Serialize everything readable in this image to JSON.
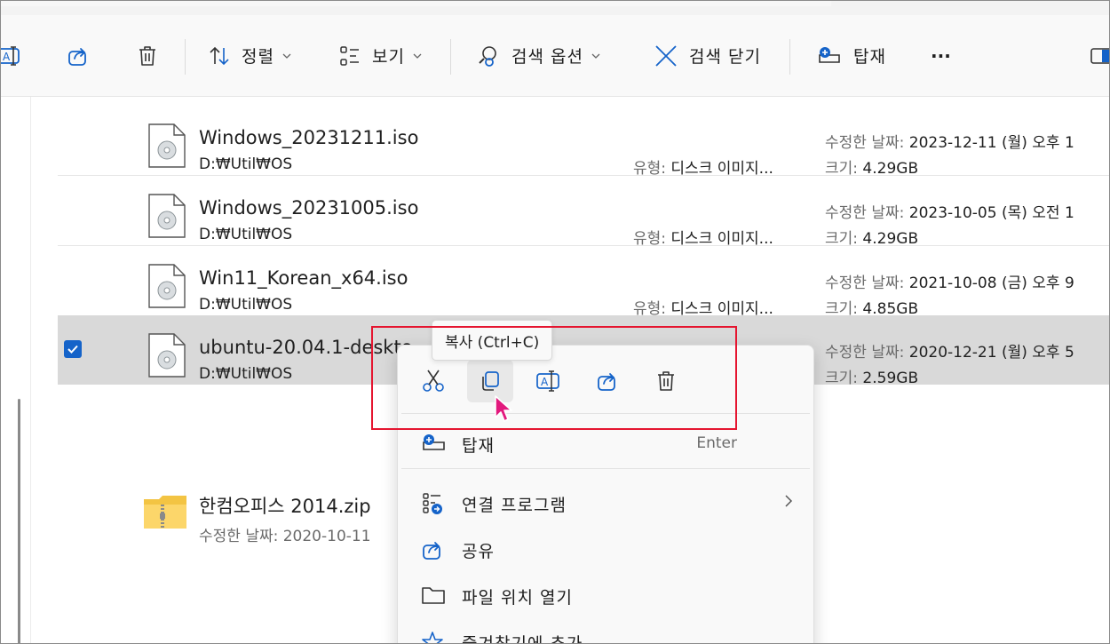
{
  "colors": {
    "accent": "#1563c9",
    "highlight": "#e51530",
    "cursor": "#e2197d"
  },
  "toolbar": {
    "sort_label": "정렬",
    "view_label": "보기",
    "search_options_label": "검색 옵션",
    "close_search_label": "검색 닫기",
    "mount_label": "탑재",
    "more_label": "···"
  },
  "files": [
    {
      "name": "Windows_20231211.iso",
      "path": "D:₩Util₩OS",
      "type_key": "유형:",
      "type_value": "디스크 이미지...",
      "date_key": "수정한 날짜:",
      "date_value": "2023-12-11 (월) 오후 1",
      "size_key": "크기:",
      "size_value": "4.29GB"
    },
    {
      "name": "Windows_20231005.iso",
      "path": "D:₩Util₩OS",
      "type_key": "유형:",
      "type_value": "디스크 이미지...",
      "date_key": "수정한 날짜:",
      "date_value": "2023-10-05 (목) 오전 1",
      "size_key": "크기:",
      "size_value": "4.29GB"
    },
    {
      "name": "Win11_Korean_x64.iso",
      "path": "D:₩Util₩OS",
      "type_key": "유형:",
      "type_value": "디스크 이미지...",
      "date_key": "수정한 날짜:",
      "date_value": "2021-10-08 (금) 오후 9",
      "size_key": "크기:",
      "size_value": "4.85GB"
    },
    {
      "name": "ubuntu-20.04.1-deskto",
      "path": "D:₩Util₩OS",
      "date_key": "수정한 날짜:",
      "date_value": "2020-12-21 (월) 오후 5",
      "size_key": "크기:",
      "size_value": "2.59GB",
      "selected": true
    }
  ],
  "zip": {
    "name": "한컴오피스 2014.zip",
    "date_text": "수정한 날짜: 2020-10-11"
  },
  "tooltip": {
    "text": "복사 (Ctrl+C)"
  },
  "menu": {
    "quick_actions": [
      "cut",
      "copy",
      "rename",
      "share",
      "delete"
    ],
    "items": [
      {
        "label": "탑재",
        "shortcut": "Enter"
      },
      {
        "label": "연결 프로그램"
      },
      {
        "label": "공유"
      },
      {
        "label": "파일 위치 열기"
      },
      {
        "label": "즐겨찾기에 추가"
      }
    ]
  }
}
